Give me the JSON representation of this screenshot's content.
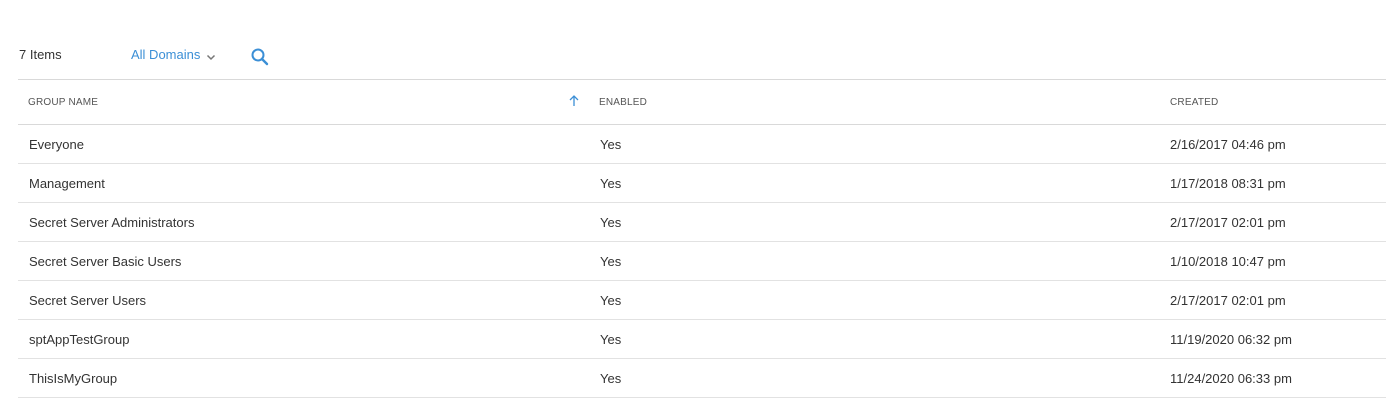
{
  "toolbar": {
    "item_count": "7 Items",
    "domain_filter": "All Domains",
    "search_icon": "search-icon",
    "chevron_icon": "chevron-down-icon"
  },
  "colors": {
    "accent": "#3b8fd6",
    "text": "#333333",
    "divider": "#e2e2e2"
  },
  "table": {
    "columns": [
      "GROUP NAME",
      "ENABLED",
      "CREATED"
    ],
    "sort": {
      "column": "GROUP NAME",
      "direction": "ascending",
      "icon": "arrow-up-icon"
    },
    "rows": [
      {
        "name": "Everyone",
        "enabled": "Yes",
        "created": "2/16/2017 04:46 pm"
      },
      {
        "name": "Management",
        "enabled": "Yes",
        "created": "1/17/2018 08:31 pm"
      },
      {
        "name": "Secret Server Administrators",
        "enabled": "Yes",
        "created": "2/17/2017 02:01 pm"
      },
      {
        "name": "Secret Server Basic Users",
        "enabled": "Yes",
        "created": "1/10/2018 10:47 pm"
      },
      {
        "name": "Secret Server Users",
        "enabled": "Yes",
        "created": "2/17/2017 02:01 pm"
      },
      {
        "name": "sptAppTestGroup",
        "enabled": "Yes",
        "created": "11/19/2020 06:32 pm"
      },
      {
        "name": "ThisIsMyGroup",
        "enabled": "Yes",
        "created": "11/24/2020 06:33 pm"
      }
    ]
  }
}
